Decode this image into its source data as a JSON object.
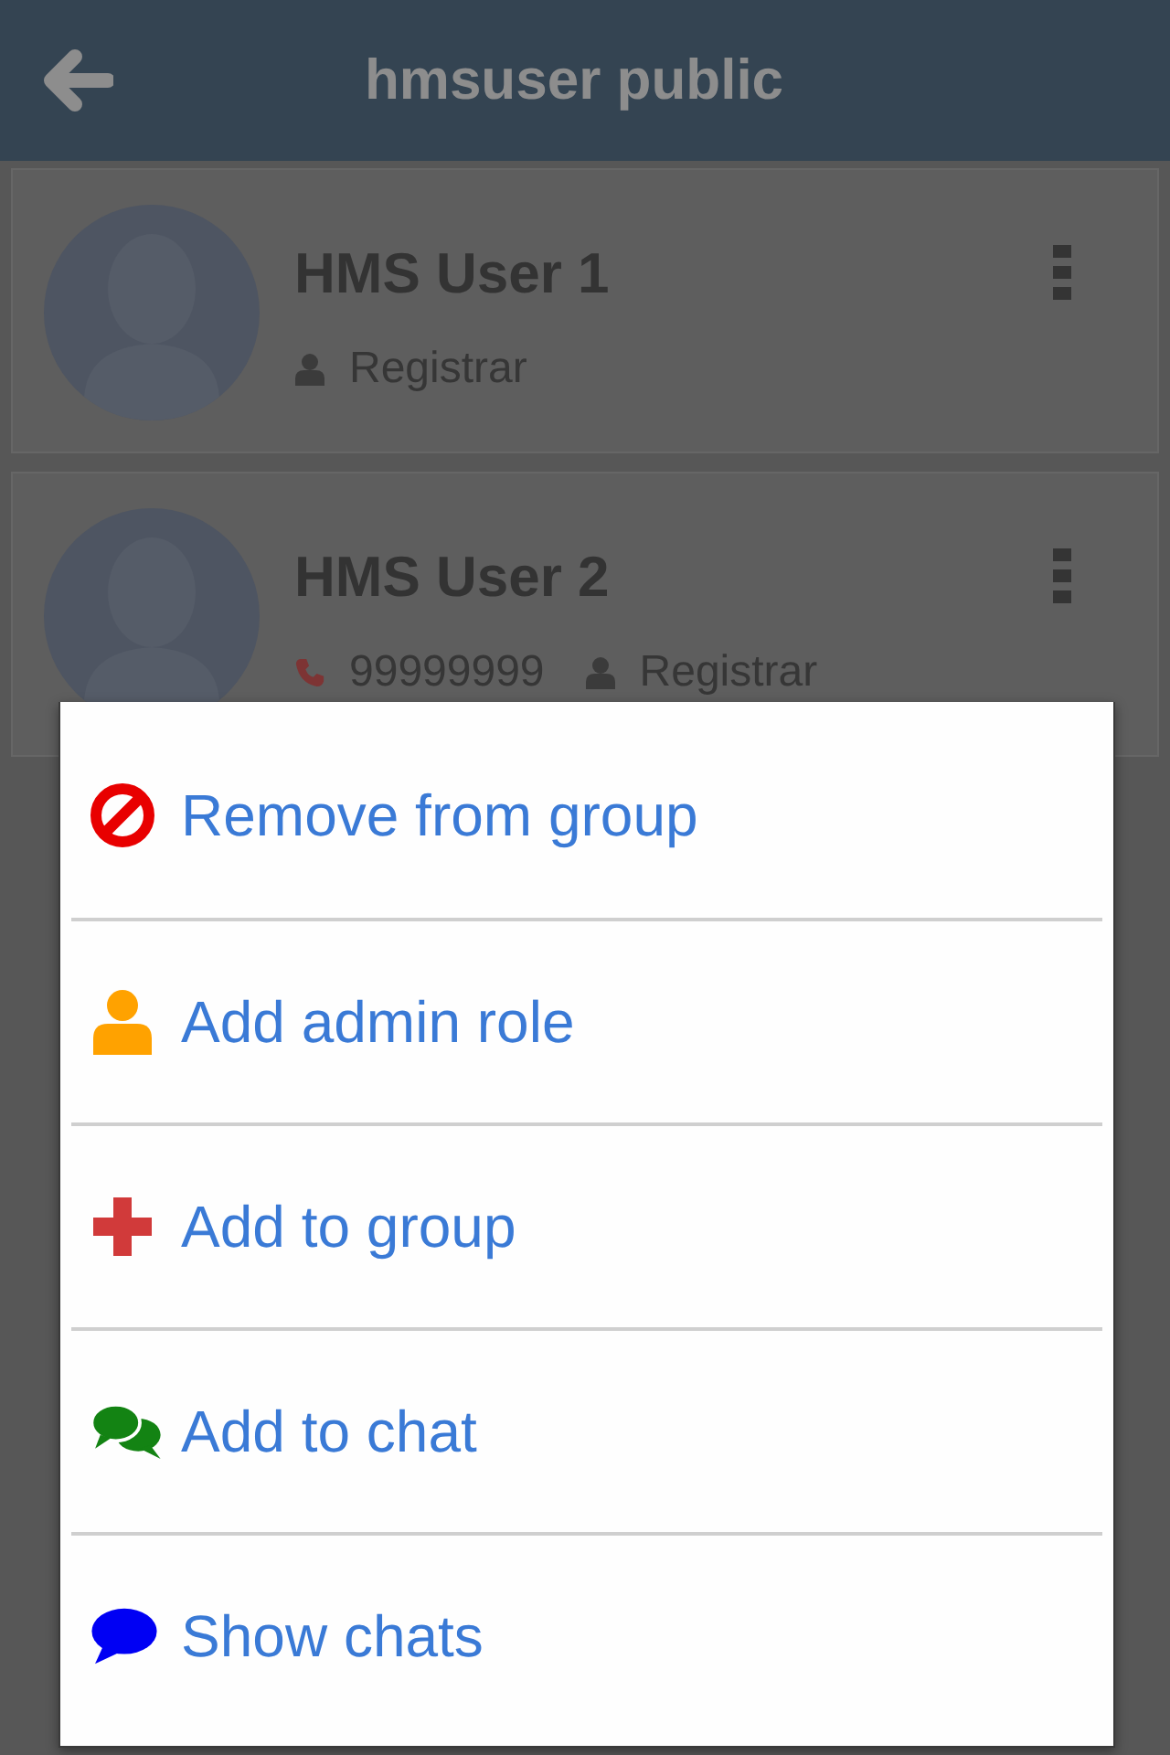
{
  "header": {
    "title": "hmsuser public"
  },
  "members": [
    {
      "name": "HMS User 1",
      "role": "Registrar"
    },
    {
      "name": "HMS User 2",
      "phone": "99999999",
      "role": "Registrar"
    }
  ],
  "menu": {
    "items": [
      {
        "kind": "remove",
        "label": "Remove from group"
      },
      {
        "kind": "admin",
        "label": "Add admin role"
      },
      {
        "kind": "add",
        "label": "Add to group"
      },
      {
        "kind": "chat",
        "label": "Add to chat"
      },
      {
        "kind": "chats",
        "label": "Show chats"
      }
    ]
  }
}
